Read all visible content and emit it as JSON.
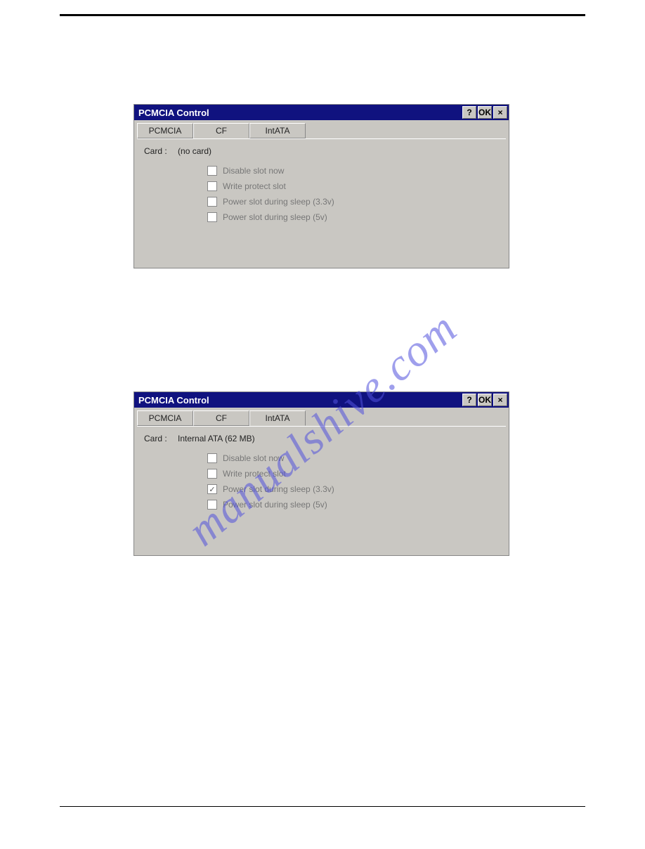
{
  "watermark": "manualshive.com",
  "windows": [
    {
      "title": "PCMCIA Control",
      "buttons": {
        "help": "?",
        "ok": "OK",
        "close": "×"
      },
      "tabs": [
        "PCMCIA",
        "CF",
        "IntATA"
      ],
      "activeTab": 1,
      "cardLabel": "Card :",
      "cardValue": "(no card)",
      "options": [
        {
          "label": "Disable slot now",
          "checked": false
        },
        {
          "label": "Write protect slot",
          "checked": false
        },
        {
          "label": "Power slot during sleep (3.3v)",
          "checked": false
        },
        {
          "label": "Power slot during sleep (5v)",
          "checked": false
        }
      ]
    },
    {
      "title": "PCMCIA Control",
      "buttons": {
        "help": "?",
        "ok": "OK",
        "close": "×"
      },
      "tabs": [
        "PCMCIA",
        "CF",
        "IntATA"
      ],
      "activeTab": 2,
      "cardLabel": "Card :",
      "cardValue": "Internal ATA (62 MB)",
      "options": [
        {
          "label": "Disable slot now",
          "checked": false
        },
        {
          "label": "Write protect slot",
          "checked": false
        },
        {
          "label": "Power slot during sleep (3.3v)",
          "checked": true
        },
        {
          "label": "Power slot during sleep (5v)",
          "checked": false
        }
      ]
    }
  ]
}
